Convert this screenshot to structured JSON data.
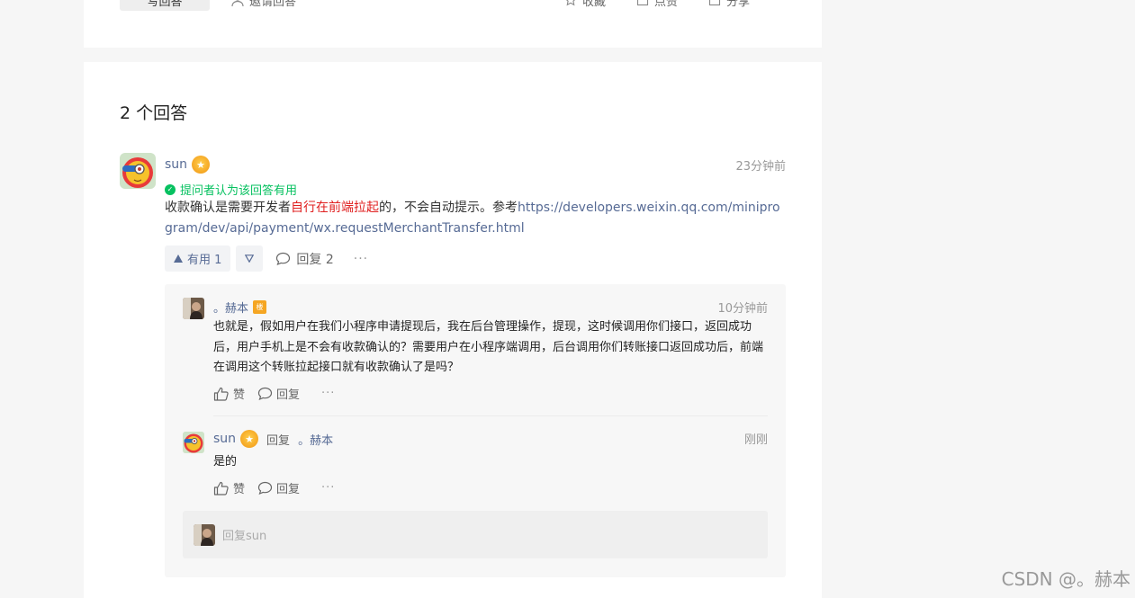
{
  "top_card": {
    "answer_button": "写回答",
    "invite": "邀请回答",
    "actions": [
      "收藏",
      "点赞",
      "分享"
    ]
  },
  "answers": {
    "title": "2 个回答",
    "answer": {
      "author": "sun",
      "time": "23分钟前",
      "accepted_label": "提问者认为该回答有用",
      "body_prefix": "收款确认是需要开发者",
      "body_highlight": "自行在前端拉起",
      "body_suffix": "的，不会自动提示。参考",
      "body_link": "https://developers.weixin.qq.com/miniprogram/dev/api/payment/wx.requestMerchantTransfer.html",
      "useful_label": "有用 1",
      "reply_label": "回复 2",
      "more": "···"
    },
    "comments": [
      {
        "author": "。赫本",
        "floor_badge": "楼",
        "time": "10分钟前",
        "body": "也就是，假如用户在我们小程序申请提现后，我在后台管理操作，提现，这时候调用你们接口，返回成功后，用户手机上是不会有收款确认的？需要用户在小程序端调用，后台调用你们转账接口返回成功后，前端在调用这个转账拉起接口就有收款确认了是吗？",
        "like": "赞",
        "reply": "回复",
        "more": "···"
      },
      {
        "author": "sun",
        "reply_word": "回复",
        "reply_to": "。赫本",
        "time": "刚刚",
        "body": "是的",
        "like": "赞",
        "reply": "回复",
        "more": "···"
      }
    ],
    "reply_placeholder": "回复sun"
  },
  "watermark": "CSDN @。赫本",
  "colors": {
    "link": "#576b95",
    "accepted": "#07c160",
    "highlight": "#e02020",
    "page_bg": "#f6f6f6"
  }
}
